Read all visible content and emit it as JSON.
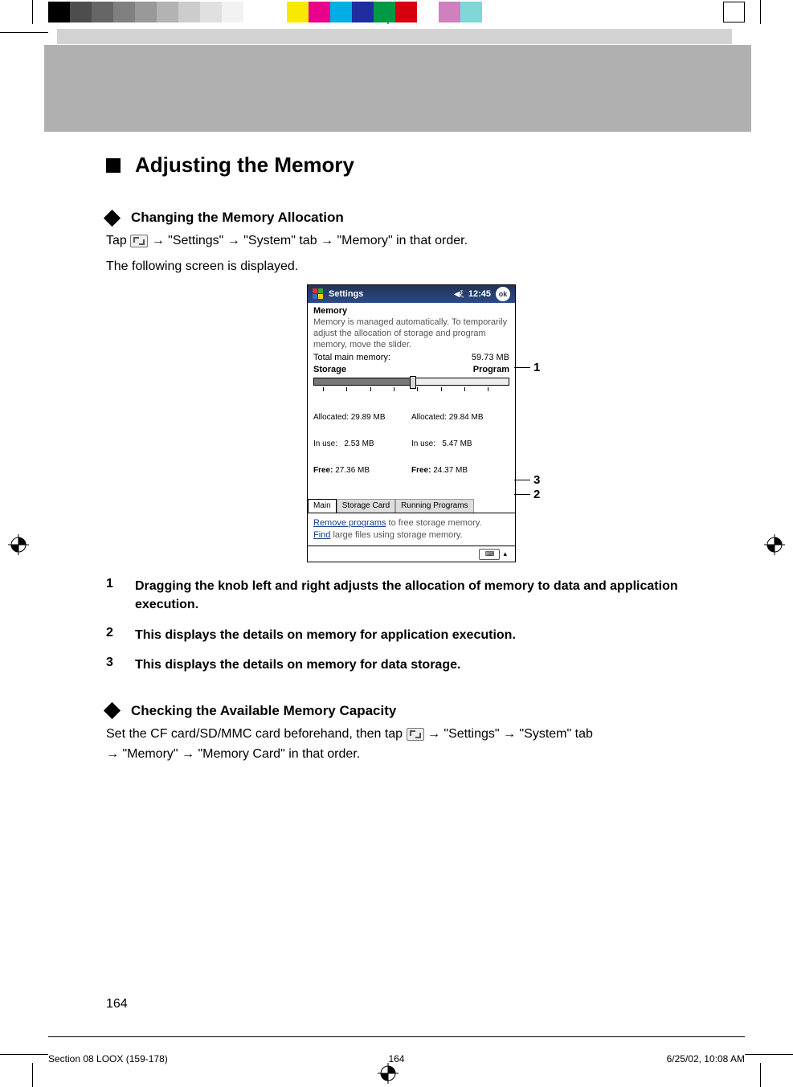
{
  "print_marks": {
    "color_swatches": [
      "#000000",
      "#4d4d4d",
      "#666666",
      "#808080",
      "#999999",
      "#b3b3b3",
      "#cccccc",
      "#e0e0e0",
      "#f2f2f2",
      "#ffffff",
      "#ffffff",
      "#f7ea00",
      "#ea008a",
      "#00aee6",
      "#1e2e9e",
      "#009944",
      "#d7000f",
      "#ffffff",
      "#d07fbf",
      "#7fd7d7",
      "#ffffff"
    ]
  },
  "headings": {
    "main": "Adjusting the Memory",
    "sub1": "Changing the Memory Allocation",
    "sub2": "Checking the Available Memory Capacity"
  },
  "body": {
    "p1_a": "Tap ",
    "p1_b": " → \"Settings\" → \"System\" tab → \"Memory\" in that order.",
    "p2": "The following screen is displayed.",
    "p3_a": "Set the CF card/SD/MMC card beforehand, then tap ",
    "p3_b": " → \"Settings\" → \"System\" tab",
    "p3_c": "→ \"Memory\" → \"Memory Card\" in that order."
  },
  "callouts": {
    "c1": "1",
    "c2": "2",
    "c3": "3"
  },
  "list": {
    "n1": "1",
    "t1": "Dragging the knob left and right adjusts the allocation of memory to data and application execution.",
    "n2": "2",
    "t2": "This displays the details on memory for application execution.",
    "n3": "3",
    "t3": "This displays the details on memory for data storage."
  },
  "screenshot": {
    "title": "Settings",
    "time": "12:45",
    "ok": "ok",
    "heading": "Memory",
    "desc": "Memory is managed automatically. To temporarily adjust the allocation of storage and program memory, move the slider.",
    "total_label": "Total main memory:",
    "total_value": "59.73 MB",
    "left_label": "Storage",
    "right_label": "Program",
    "storage_allocated": "Allocated: 29.89 MB",
    "storage_inuse": "In use:   2.53 MB",
    "storage_free_l": "Free:",
    "storage_free_v": " 27.36 MB",
    "program_allocated": "Allocated: 29.84 MB",
    "program_inuse": "In use:   5.47 MB",
    "program_free_l": "Free:",
    "program_free_v": " 24.37 MB",
    "tab_main": "Main",
    "tab_storage": "Storage Card",
    "tab_running": "Running Programs",
    "link1_a": "Remove programs",
    "link1_b": " to free storage memory.",
    "link2_a": "Find",
    "link2_b": " large files using storage memory."
  },
  "page_number": "164",
  "footer": {
    "left": "Section 08 LOOX (159-178)",
    "middle": "164",
    "right": "6/25/02, 10:08 AM"
  }
}
